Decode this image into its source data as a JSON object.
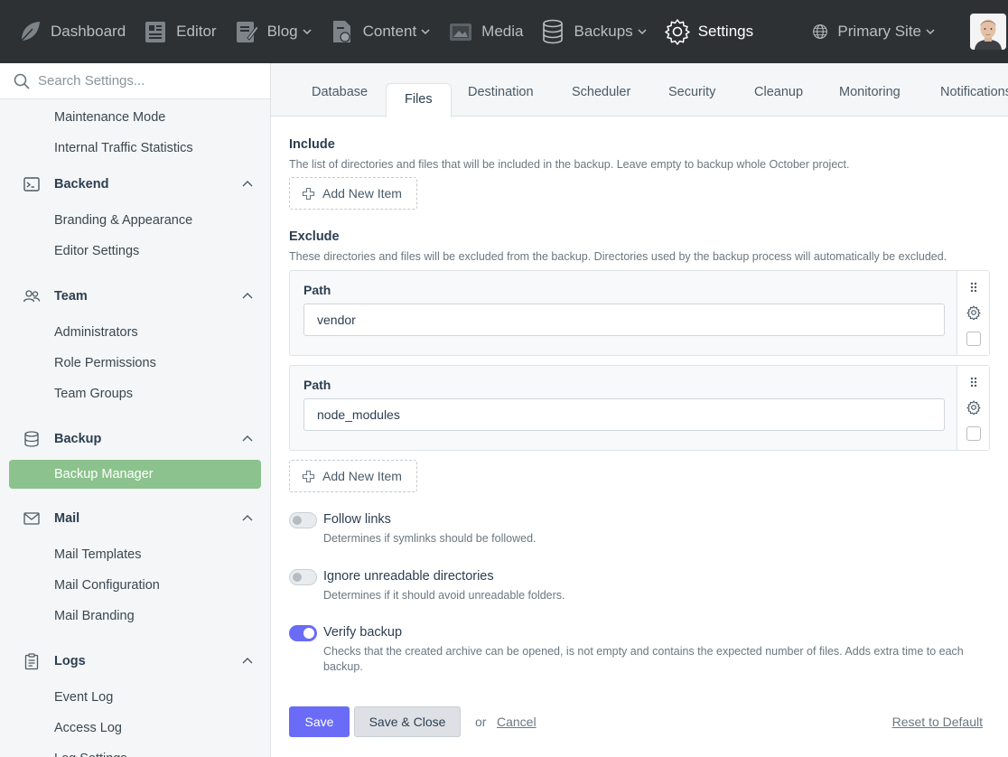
{
  "topnav": {
    "items": [
      {
        "label": "Dashboard",
        "icon": "leaf-icon"
      },
      {
        "label": "Editor",
        "icon": "editor-icon"
      },
      {
        "label": "Blog",
        "icon": "blog-icon"
      },
      {
        "label": "Content",
        "icon": "content-icon"
      },
      {
        "label": "Media",
        "icon": "media-icon"
      },
      {
        "label": "Backups",
        "icon": "database-icon"
      },
      {
        "label": "Settings",
        "icon": "gear-icon"
      }
    ],
    "site_label": "Primary Site"
  },
  "sidebar": {
    "search_placeholder": "Search Settings...",
    "top_links": [
      "Maintenance Mode",
      "Internal Traffic Statistics"
    ],
    "groups": [
      {
        "title": "Backend",
        "items": [
          "Branding & Appearance",
          "Editor Settings"
        ]
      },
      {
        "title": "Team",
        "items": [
          "Administrators",
          "Role Permissions",
          "Team Groups"
        ]
      },
      {
        "title": "Backup",
        "items": [
          "Backup Manager"
        ]
      },
      {
        "title": "Mail",
        "items": [
          "Mail Templates",
          "Mail Configuration",
          "Mail Branding"
        ]
      },
      {
        "title": "Logs",
        "items": [
          "Event Log",
          "Access Log",
          "Log Settings"
        ]
      }
    ]
  },
  "tabs": [
    "Database",
    "Files",
    "Destination",
    "Scheduler",
    "Security",
    "Cleanup",
    "Monitoring",
    "Notifications"
  ],
  "include": {
    "title": "Include",
    "description": "The list of directories and files that will be included in the backup. Leave empty to backup whole October project.",
    "add_label": "Add New Item"
  },
  "exclude": {
    "title": "Exclude",
    "description": "These directories and files will be excluded from the backup. Directories used by the backup process will automatically be excluded.",
    "items": [
      {
        "label": "Path",
        "value": "vendor"
      },
      {
        "label": "Path",
        "value": "node_modules"
      }
    ],
    "add_label": "Add New Item"
  },
  "switches": [
    {
      "label": "Follow links",
      "desc": "Determines if symlinks should be followed.",
      "on": false
    },
    {
      "label": "Ignore unreadable directories",
      "desc": "Determines if it should avoid unreadable folders.",
      "on": false
    },
    {
      "label": "Verify backup",
      "desc": "Checks that the created archive can be opened, is not empty and contains the expected number of files. Adds extra time to each backup.",
      "on": true
    }
  ],
  "actions": {
    "save": "Save",
    "save_close": "Save & Close",
    "or": "or",
    "cancel": "Cancel",
    "reset": "Reset to Default"
  },
  "colors": {
    "topbar": "#2d3134",
    "accent": "#6a6cf7",
    "active_sidebar": "#8cc28d"
  }
}
